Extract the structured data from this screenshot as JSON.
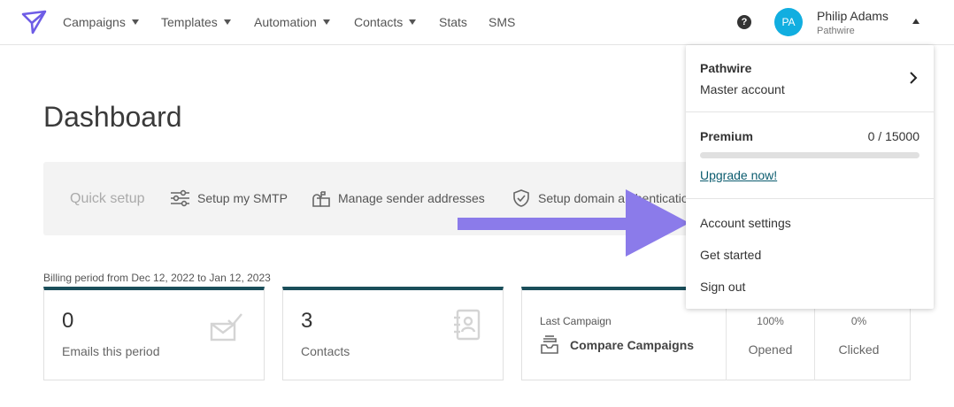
{
  "nav": {
    "logo_icon": "paper-plane-icon",
    "items": [
      {
        "label": "Campaigns",
        "has_caret": true
      },
      {
        "label": "Templates",
        "has_caret": true
      },
      {
        "label": "Automation",
        "has_caret": true
      },
      {
        "label": "Contacts",
        "has_caret": true
      },
      {
        "label": "Stats",
        "has_caret": false
      },
      {
        "label": "SMS",
        "has_caret": false
      }
    ],
    "help_label": "?",
    "user": {
      "initials": "PA",
      "name": "Philip Adams",
      "org": "Pathwire",
      "avatar_color": "#11aee0"
    }
  },
  "dashboard": {
    "title": "Dashboard",
    "quick_setup": {
      "label": "Quick setup",
      "items": [
        {
          "label": "Setup my SMTP",
          "icon": "sliders-icon"
        },
        {
          "label": "Manage sender addresses",
          "icon": "mailbox-icon"
        },
        {
          "label": "Setup domain authenticatio",
          "icon": "shield-check-icon"
        }
      ]
    },
    "billing_period": "Billing period from Dec 12, 2022 to Jan 12, 2023",
    "cards": {
      "emails": {
        "value": "0",
        "label": "Emails this period",
        "icon": "envelope-check-icon"
      },
      "contacts": {
        "value": "3",
        "label": "Contacts",
        "icon": "address-book-icon"
      },
      "campaign": {
        "label": "Last Campaign",
        "compare_label": "Compare Campaigns",
        "compare_icon": "inbox-icon",
        "opened_pct": "100%",
        "opened_label": "Opened",
        "clicked_pct": "0%",
        "clicked_label": "Clicked"
      }
    },
    "accent_color": "#1a4e5a"
  },
  "dropdown": {
    "account_name": "Pathwire",
    "account_role": "Master account",
    "plan_name": "Premium",
    "plan_usage": "0 / 15000",
    "plan_usage_fraction": 0,
    "upgrade_label": "Upgrade now!",
    "menu": [
      {
        "label": "Account settings"
      },
      {
        "label": "Get started"
      },
      {
        "label": "Sign out"
      }
    ]
  },
  "annotation": {
    "arrow_color": "#8b7bea",
    "arrow_target": "Account settings"
  }
}
